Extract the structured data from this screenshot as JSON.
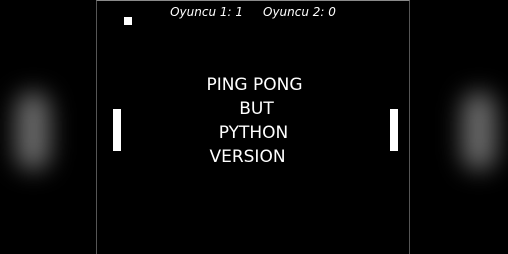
{
  "scoreboard": {
    "player1": "Oyuncu 1: 1",
    "player2": "Oyuncu 2: 0"
  },
  "title": {
    "line1": "PING PONG",
    "line2": "BUT",
    "line3": "PYTHON",
    "line4": "VERSION"
  },
  "colors": {
    "background": "#000000",
    "foreground": "#ffffff"
  }
}
